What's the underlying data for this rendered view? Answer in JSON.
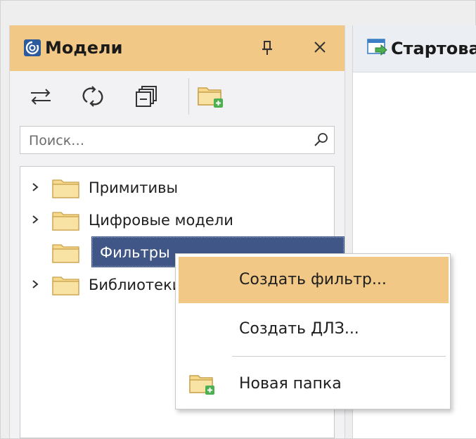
{
  "panel": {
    "title": "Модели",
    "search_placeholder": "Поиск…",
    "tree_items": [
      {
        "label": "Примитивы",
        "has_children": true
      },
      {
        "label": "Цифровые модели",
        "has_children": true
      },
      {
        "label": "Фильтры",
        "has_children": false,
        "selected": true
      },
      {
        "label": "Библиотеки",
        "has_children": true
      }
    ],
    "toolbar_icons": [
      "swap-icon",
      "refresh-icon",
      "collapse-all-icon",
      "new-folder-icon"
    ]
  },
  "document_tab": {
    "label": "Стартовая страница"
  },
  "context_menu": {
    "items": [
      {
        "label": "Создать фильтр...",
        "highlighted": true
      },
      {
        "label": "Создать ДЛЗ...",
        "highlighted": false
      },
      {
        "label": "Новая папка",
        "icon": "new-folder-icon",
        "highlighted": false
      }
    ]
  },
  "colors": {
    "header_accent": "#f1c886",
    "selection": "#3f5686",
    "folder": "#f6d98c"
  }
}
